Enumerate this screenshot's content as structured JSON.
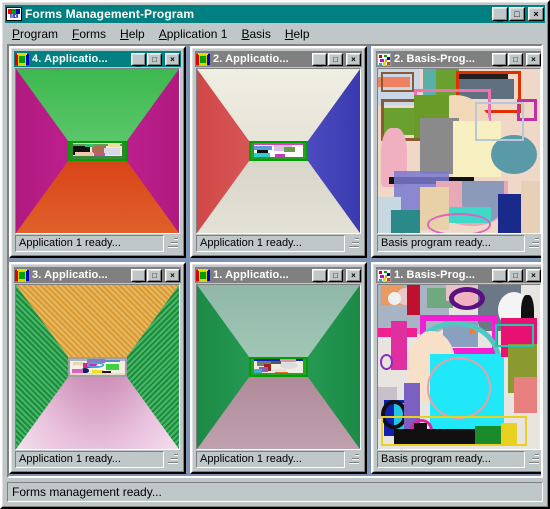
{
  "app": {
    "title": "Forms Management-Program",
    "icon": "mdi-icon",
    "buttons": {
      "minimize": "_",
      "maximize": "□",
      "close": "×"
    },
    "menu": [
      {
        "label": "Program",
        "accel": "P"
      },
      {
        "label": "Forms",
        "accel": "F"
      },
      {
        "label": "Help",
        "accel": "H"
      },
      {
        "label": "Application 1",
        "accel": "A"
      },
      {
        "label": "Basis",
        "accel": "B"
      },
      {
        "label": "Help",
        "accel": "H"
      }
    ],
    "statusbar": "Forms management ready..."
  },
  "colors": {
    "title_active": "#008080",
    "title_inactive": "#808080",
    "face": "#c0c7c8",
    "mdi_background": "#8193b2",
    "text": "#000000"
  },
  "windows": [
    {
      "id": "app4",
      "title": "4. Applicatio...",
      "icon": "spool-icon",
      "active": true,
      "status": "Application 1 ready...",
      "scene": {
        "type": "perspective-room",
        "ceiling": "#55c463",
        "floor": "#c03a10",
        "left_wall": "#cc2299",
        "right_wall": "#cc2299",
        "picture_border": "#00a000"
      }
    },
    {
      "id": "basis2",
      "title": "2. Basis-Prog...",
      "icon": "confetti-icon",
      "active": false,
      "status": "Basis program ready...",
      "scene": {
        "type": "abstract-art",
        "background": "#f4d9c8"
      }
    },
    {
      "id": "app2",
      "title": "2. Applicatio...",
      "icon": "spool-icon",
      "active": false,
      "status": "Application 1 ready...",
      "scene": {
        "type": "perspective-room",
        "ceiling": "#e8e6d8",
        "floor": "#d3d0c4",
        "left_wall": "#e05c5c",
        "right_wall": "#5c5ccc",
        "picture_border": "#00a000"
      }
    },
    {
      "id": "app3",
      "title": "3. Applicatio...",
      "icon": "spool-icon",
      "active": false,
      "status": "Application 1 ready...",
      "scene": {
        "type": "perspective-room",
        "ceiling": "#dda040",
        "floor": "#e8c0d8",
        "left_wall": "#2fa84f",
        "right_wall": "#2fa84f",
        "picture_border": "#c0c0c0"
      }
    },
    {
      "id": "app1",
      "title": "1. Applicatio...",
      "icon": "spool-icon",
      "active": false,
      "status": "Application 1 ready...",
      "scene": {
        "type": "perspective-room",
        "ceiling": "#8fbba4",
        "floor": "#b08a9a",
        "left_wall": "#2aa05a",
        "right_wall": "#2aa05a",
        "picture_border": "#00a000"
      }
    },
    {
      "id": "basis1",
      "title": "1. Basis-Prog...",
      "icon": "confetti-icon",
      "active": false,
      "status": "Basis program ready...",
      "scene": {
        "type": "abstract-art",
        "background": "#c8d2dc"
      }
    }
  ]
}
